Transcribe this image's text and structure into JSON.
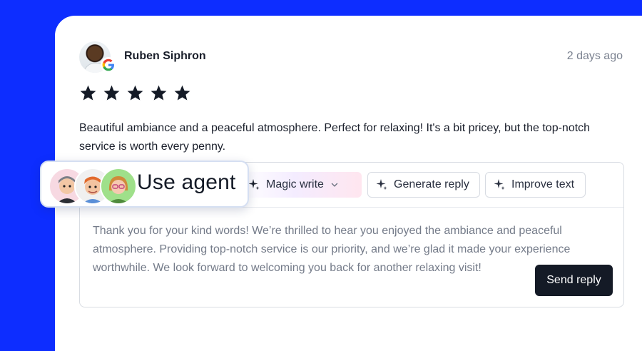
{
  "review": {
    "author": "Ruben Siphron",
    "time_ago": "2 days ago",
    "rating": 5,
    "text": "Beautiful ambiance and a peaceful atmosphere. Perfect for relaxing! It's a bit pricey, but the top-notch service is worth every penny."
  },
  "toolbar": {
    "magic_write_label": "Magic write",
    "generate_reply_label": "Generate reply",
    "improve_text_label": "Improve text"
  },
  "reply": {
    "text": "Thank you for your kind words! We’re thrilled to hear you enjoyed the ambiance and peaceful atmosphere. Providing top-notch service is our priority, and we’re glad it made your experience worthwhile. We look forward to welcoming you back for another relaxing visit!",
    "send_label": "Send reply"
  },
  "agent": {
    "label": "Use agent"
  },
  "colors": {
    "background": "#0d2dff",
    "text_dark": "#1a1f2b",
    "muted": "#7b8290",
    "send_button": "#141a26"
  },
  "icons": {
    "source": "google-icon",
    "star": "star-icon",
    "sparkle": "sparkle-icon",
    "dropdown": "chevron-down-icon"
  }
}
